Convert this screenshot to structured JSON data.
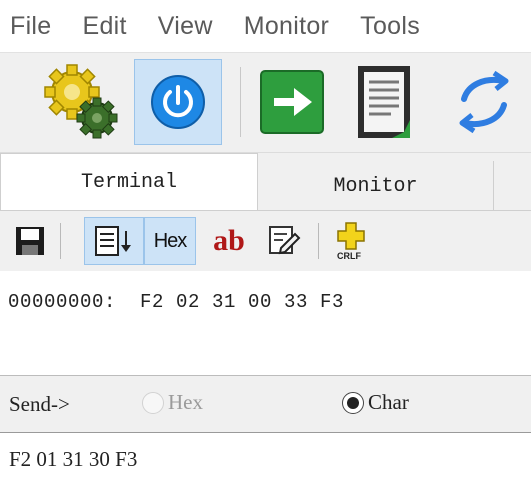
{
  "menu": {
    "items": [
      {
        "label": "File"
      },
      {
        "label": "Edit"
      },
      {
        "label": "View"
      },
      {
        "label": "Monitor"
      },
      {
        "label": "Tools"
      }
    ]
  },
  "toolbar": {
    "buttons": [
      {
        "icon": "gears-icon"
      },
      {
        "icon": "power-icon",
        "active": true
      },
      {
        "icon": "arrow-right-icon"
      },
      {
        "icon": "document-icon"
      },
      {
        "icon": "refresh-arrows-icon"
      }
    ]
  },
  "tabs": [
    {
      "label": "Terminal",
      "selected": true
    },
    {
      "label": "Monitor",
      "selected": false
    }
  ],
  "subtoolbar": {
    "hex_label": "Hex",
    "ab_label": "ab",
    "crlf_label": "CRLF"
  },
  "terminal": {
    "lines": [
      "00000000:  F2 02 31 00 33 F3"
    ]
  },
  "send": {
    "label": "Send->",
    "hex_option": "Hex",
    "char_option": "Char",
    "selected": "Char",
    "input_value": "F2 01 31 30 F3"
  },
  "colors": {
    "active_bg": "#cde3f7",
    "active_border": "#9bc4ea",
    "power_blue": "#1e88e5",
    "arrow_green": "#2e9e3e",
    "ab_red": "#b01818"
  }
}
